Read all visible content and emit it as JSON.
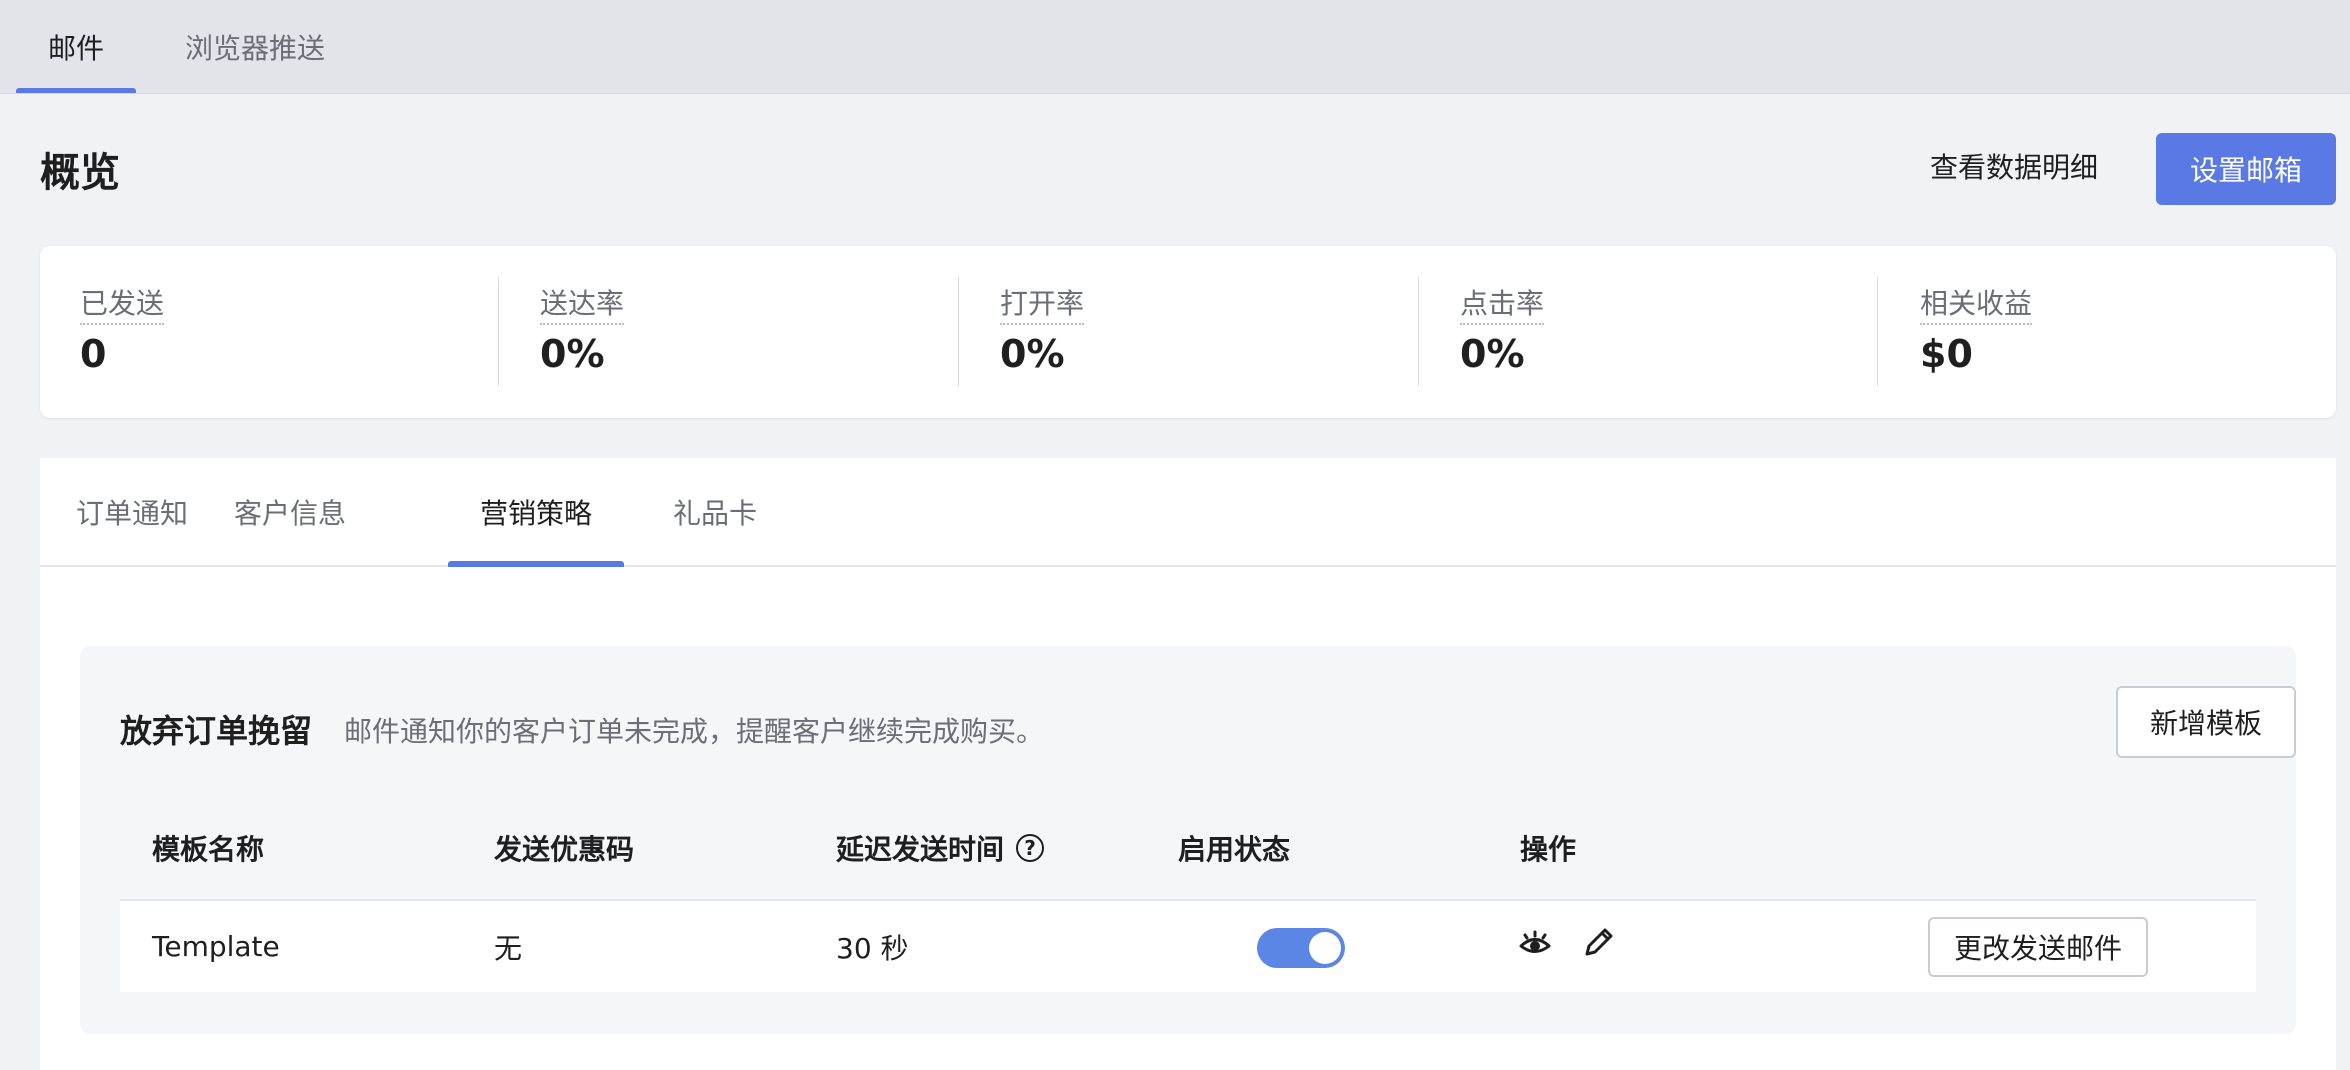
{
  "top_tabs": [
    {
      "label": "邮件",
      "active": true
    },
    {
      "label": "浏览器推送",
      "active": false
    }
  ],
  "header": {
    "title": "概览",
    "view_details_label": "查看数据明细",
    "setup_mailbox_label": "设置邮箱"
  },
  "stats": [
    {
      "label": "已发送",
      "value": "0"
    },
    {
      "label": "送达率",
      "value": "0%"
    },
    {
      "label": "打开率",
      "value": "0%"
    },
    {
      "label": "点击率",
      "value": "0%"
    },
    {
      "label": "相关收益",
      "value": "$0"
    }
  ],
  "sub_tabs": [
    {
      "label": "订单通知",
      "active": false
    },
    {
      "label": "客户信息",
      "active": false
    },
    {
      "label": "营销策略",
      "active": true
    },
    {
      "label": "礼品卡",
      "active": false
    }
  ],
  "strategy": {
    "title": "放弃订单挽留",
    "description": "邮件通知你的客户订单未完成，提醒客户继续完成购买。",
    "add_template_label": "新增模板"
  },
  "table": {
    "columns": [
      "模板名称",
      "发送优惠码",
      "延迟发送时间",
      "启用状态",
      "操作"
    ],
    "help_icon": "question-circle-icon",
    "rows": [
      {
        "name": "Template",
        "coupon": "无",
        "delay": "30 秒",
        "enabled": true,
        "actions": [
          "eye-icon",
          "pencil-icon"
        ],
        "change_email_label": "更改发送邮件"
      }
    ]
  },
  "colors": {
    "accent": "#5b79e4",
    "toggle_on": "#5b86e6",
    "page_bg": "#f1f2f4",
    "tabbar_bg": "#e2e4ea"
  }
}
